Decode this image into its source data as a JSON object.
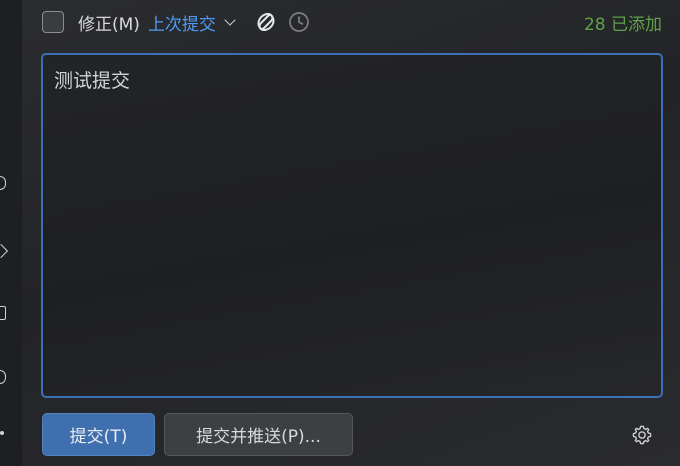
{
  "toolbar": {
    "amend_label": "修正(M)",
    "last_commit_label": "上次提交",
    "added_count": "28 已添加"
  },
  "message": {
    "value": "测试提交"
  },
  "buttons": {
    "commit_label": "提交(T)",
    "commit_push_label": "提交并推送(P)..."
  },
  "icons": {
    "ai": "ai-assistant-icon",
    "history": "clock-history-icon",
    "settings": "gear-icon"
  },
  "colors": {
    "accent_blue": "#4e9cf2",
    "added_green": "#5fa14a",
    "focus_border": "#3c6fb5",
    "primary_button": "#3f6fae"
  }
}
